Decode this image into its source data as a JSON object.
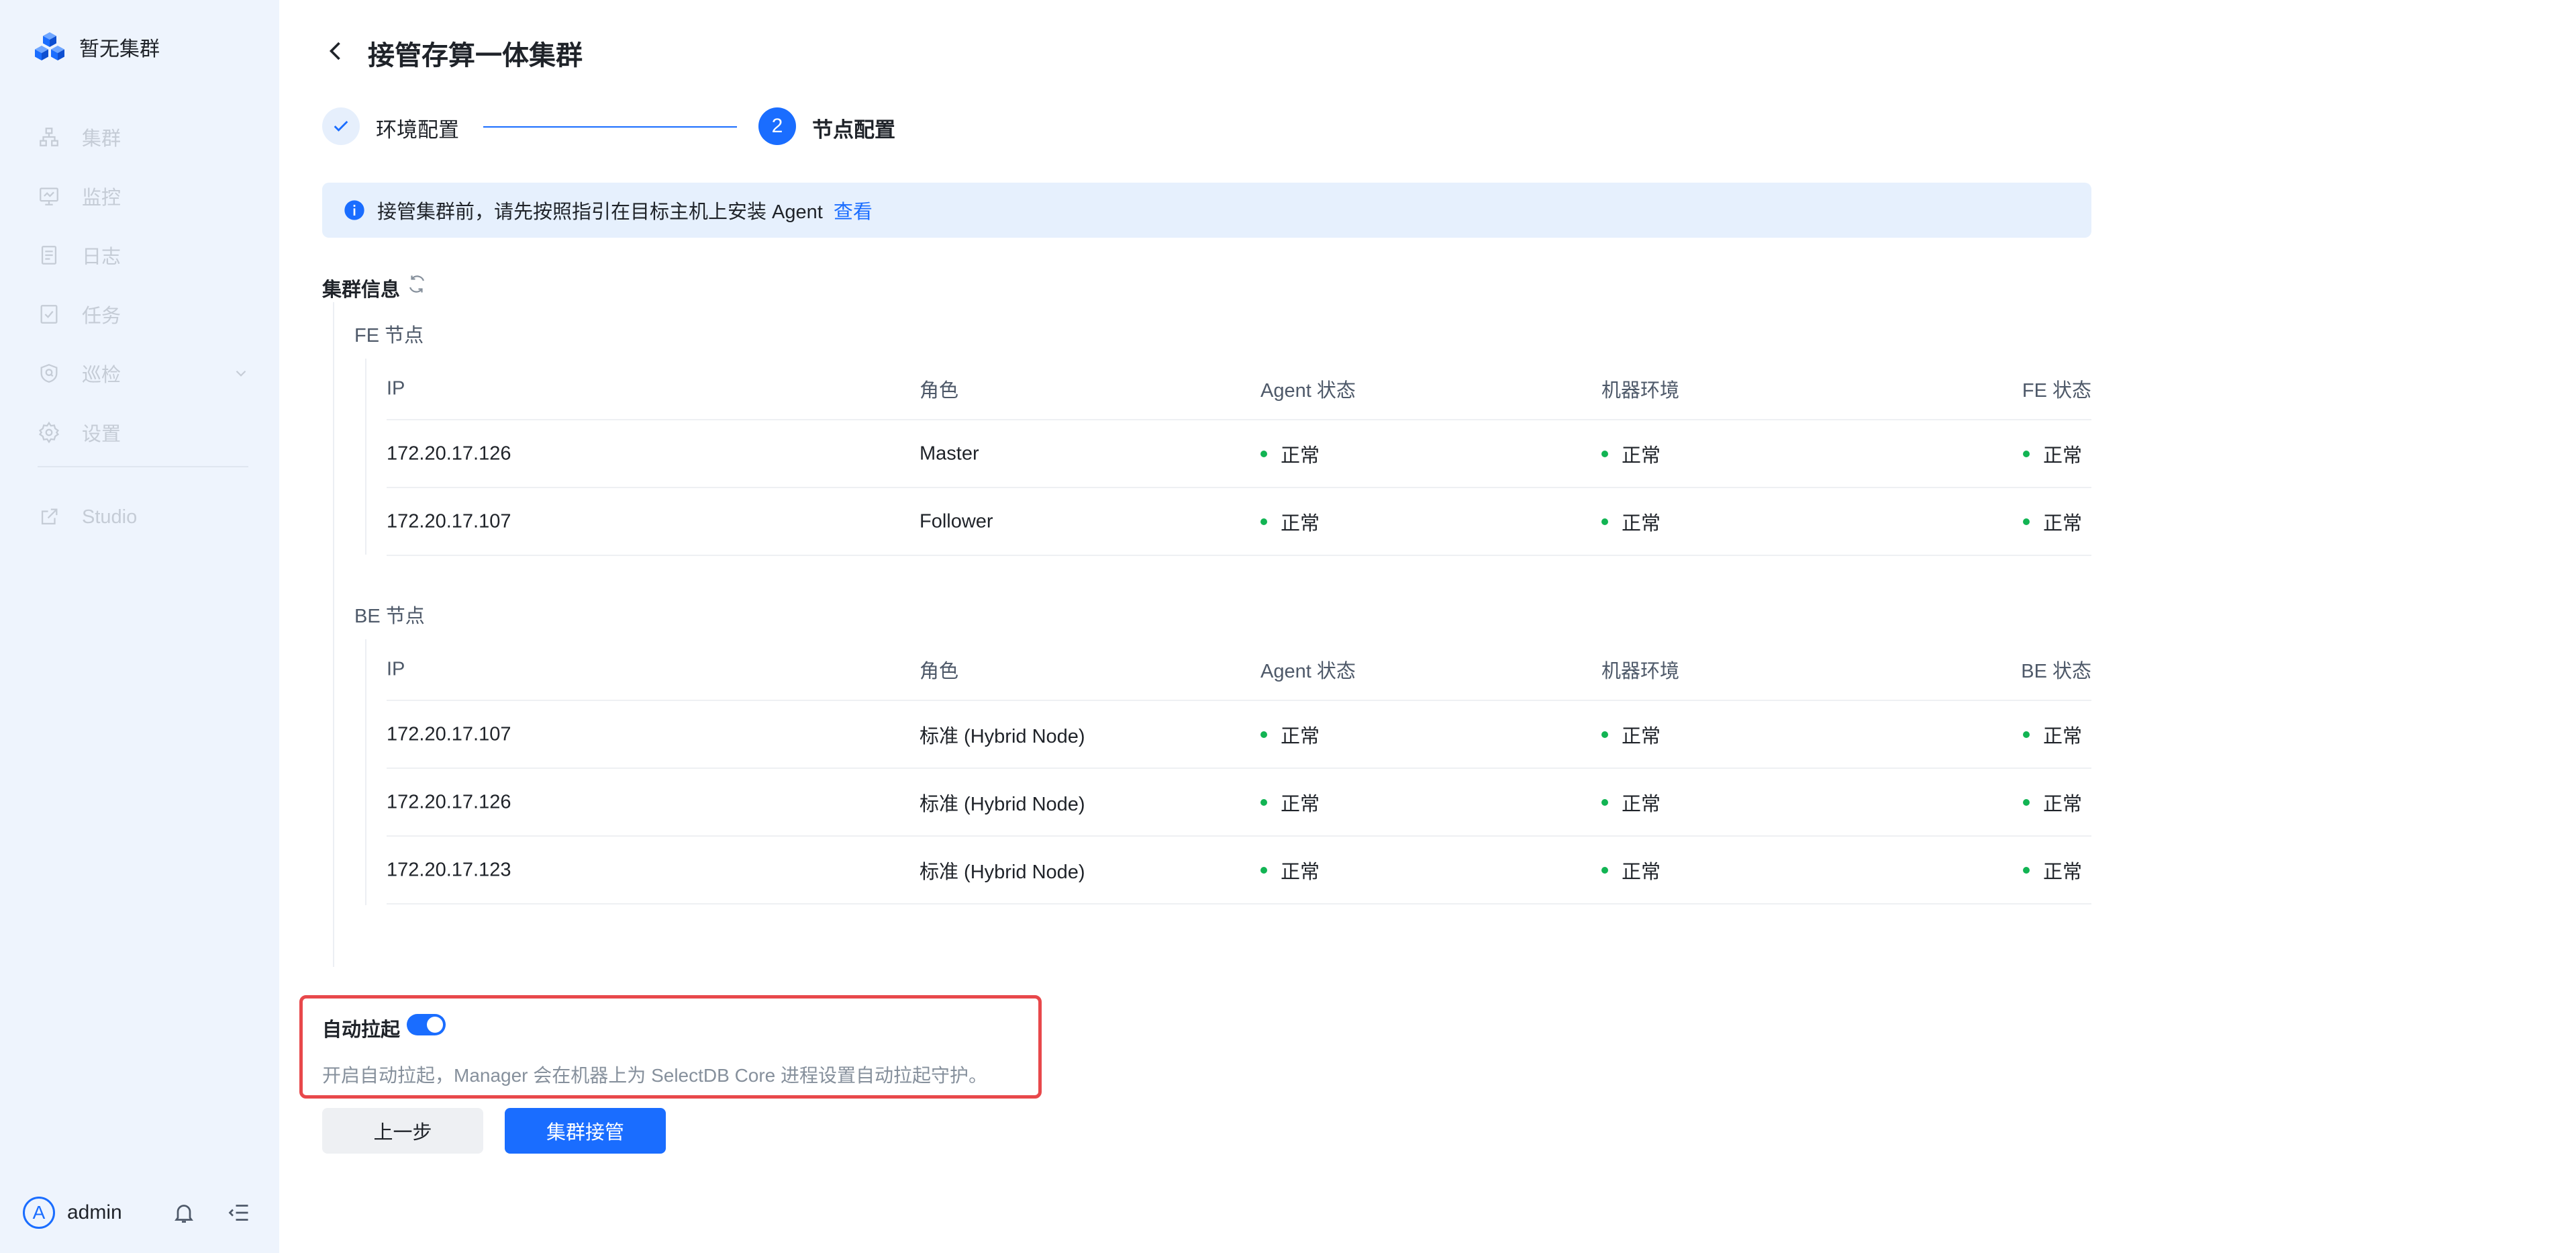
{
  "sidebar": {
    "brand": "暂无集群",
    "items": [
      {
        "label": "集群",
        "icon": "cluster-icon"
      },
      {
        "label": "监控",
        "icon": "monitor-icon"
      },
      {
        "label": "日志",
        "icon": "log-icon"
      },
      {
        "label": "任务",
        "icon": "task-icon"
      },
      {
        "label": "巡检",
        "icon": "inspection-icon"
      },
      {
        "label": "设置",
        "icon": "settings-icon"
      },
      {
        "label": "Studio",
        "icon": "external-link-icon"
      }
    ],
    "user": {
      "avatar_letter": "A",
      "name": "admin"
    }
  },
  "header": {
    "title": "接管存算一体集群"
  },
  "steps": [
    {
      "label": "环境配置",
      "status": "done"
    },
    {
      "number": "2",
      "label": "节点配置",
      "status": "active"
    }
  ],
  "banner": {
    "text": "接管集群前，请先按照指引在目标主机上安装 Agent",
    "link": "查看"
  },
  "cluster_info": {
    "title": "集群信息",
    "fe": {
      "title": "FE 节点",
      "headers": [
        "IP",
        "角色",
        "Agent 状态",
        "机器环境",
        "FE 状态"
      ],
      "rows": [
        [
          "172.20.17.126",
          "Master",
          "正常",
          "正常",
          "正常"
        ],
        [
          "172.20.17.107",
          "Follower",
          "正常",
          "正常",
          "正常"
        ]
      ]
    },
    "be": {
      "title": "BE 节点",
      "headers": [
        "IP",
        "角色",
        "Agent 状态",
        "机器环境",
        "BE 状态"
      ],
      "rows": [
        [
          "172.20.17.107",
          "标准 (Hybrid Node)",
          "正常",
          "正常",
          "正常"
        ],
        [
          "172.20.17.126",
          "标准 (Hybrid Node)",
          "正常",
          "正常",
          "正常"
        ],
        [
          "172.20.17.123",
          "标准 (Hybrid Node)",
          "正常",
          "正常",
          "正常"
        ]
      ]
    }
  },
  "auto_start": {
    "label": "自动拉起",
    "enabled": true,
    "description": "开启自动拉起，Manager 会在机器上为 SelectDB Core 进程设置自动拉起守护。"
  },
  "buttons": {
    "prev": "上一步",
    "submit": "集群接管"
  },
  "colors": {
    "primary": "#1a6dff",
    "success": "#12b453",
    "highlight": "#e8484b",
    "sidebar_bg": "#eef4fd"
  }
}
